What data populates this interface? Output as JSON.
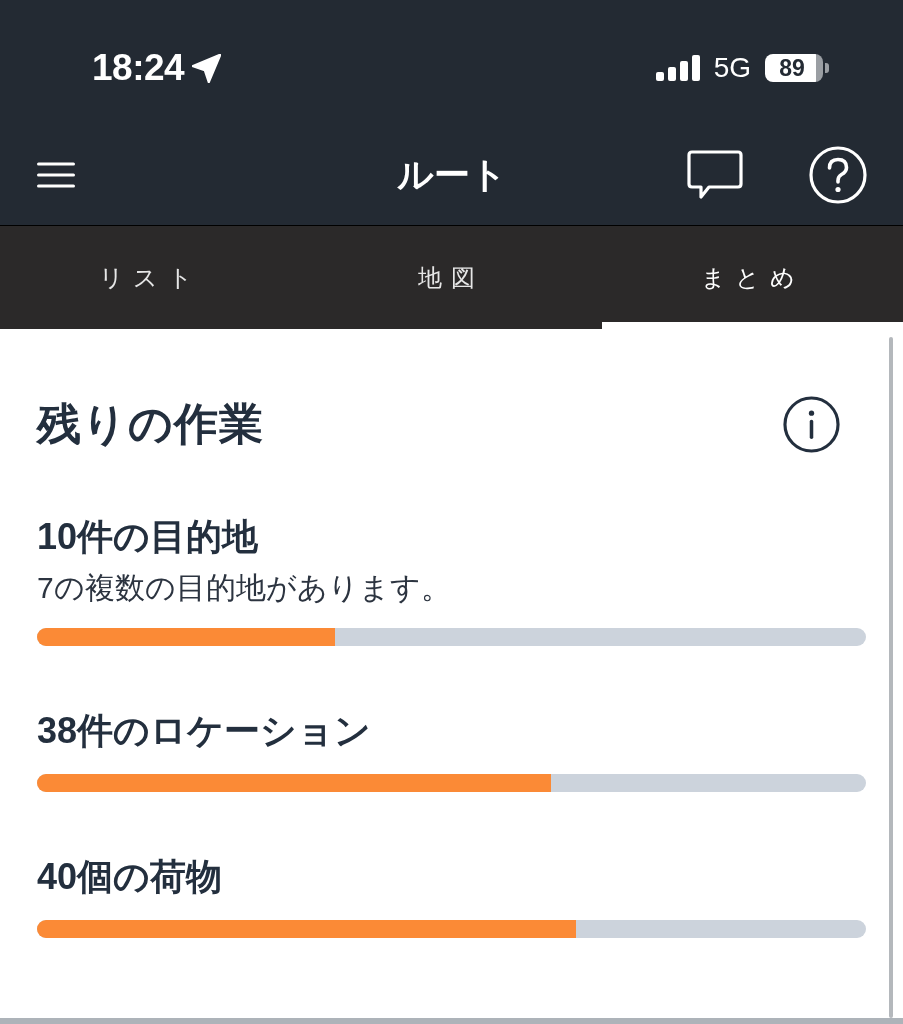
{
  "status_bar": {
    "time": "18:24",
    "network": "5G",
    "battery": "89"
  },
  "header": {
    "title": "ルート"
  },
  "tabs": [
    {
      "label": "リスト",
      "selected": false
    },
    {
      "label": "地図",
      "selected": false
    },
    {
      "label": "まとめ",
      "selected": true
    }
  ],
  "summary": {
    "title": "残りの作業",
    "items": [
      {
        "title": "10件の目的地",
        "subtitle": "7の複数の目的地があります。",
        "level": 0.36
      },
      {
        "title": "38件のロケーション",
        "level": 0.62
      },
      {
        "title": "40個の荷物",
        "level": 0.65
      }
    ]
  }
}
